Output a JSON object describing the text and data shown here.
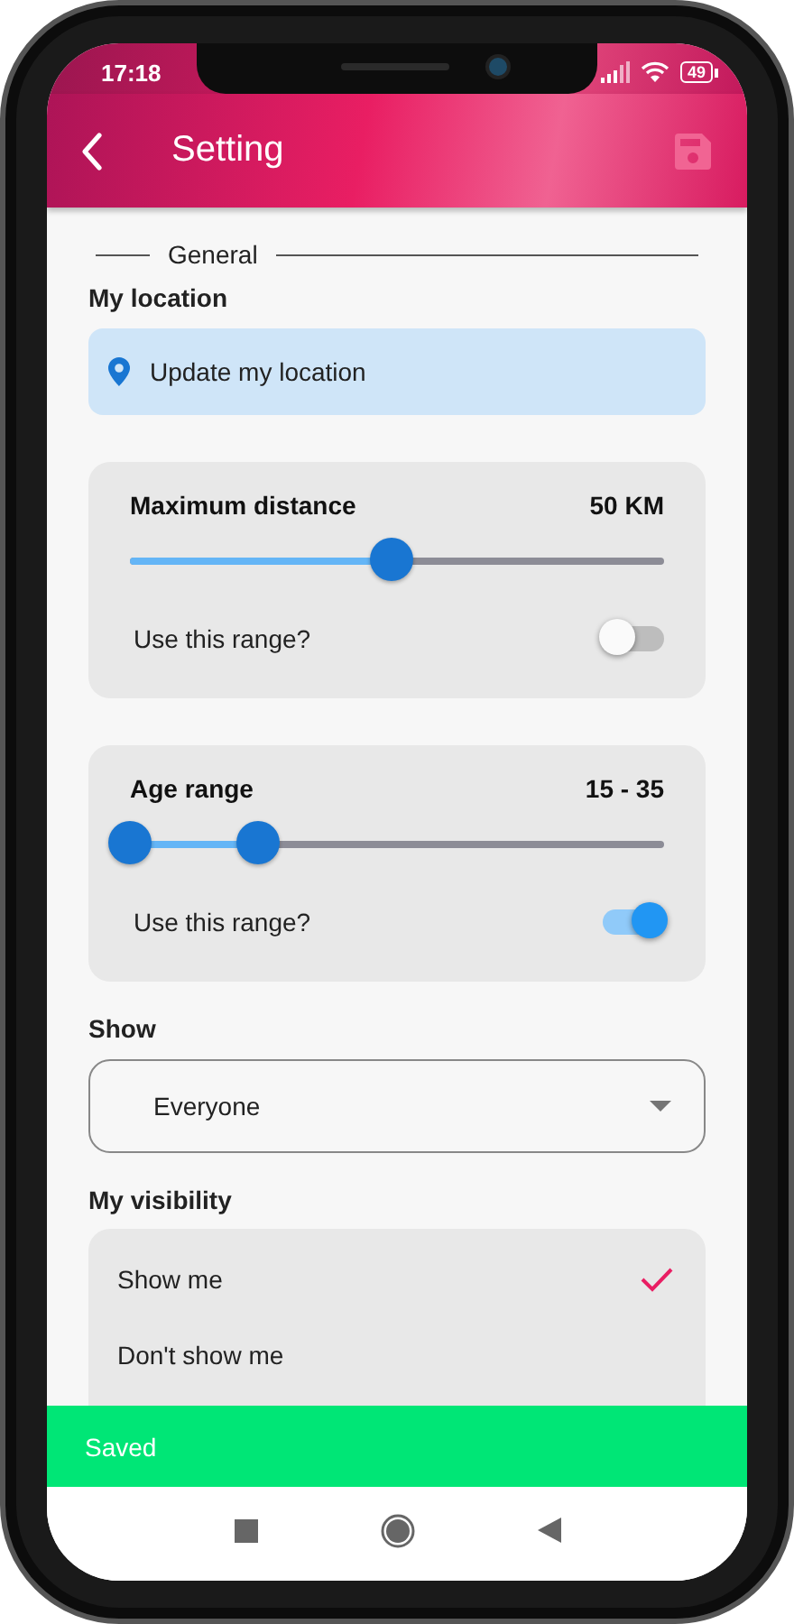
{
  "status_bar": {
    "time": "17:18",
    "battery": "49"
  },
  "app_bar": {
    "title": "Setting"
  },
  "section": {
    "title": "General"
  },
  "location": {
    "label": "My location",
    "button": "Update my location"
  },
  "filters": [
    {
      "kind": "single",
      "title": "Maximum distance",
      "value": "50 KM",
      "thumbs": [
        {
          "level": 0.49
        }
      ],
      "toggle_label": "Use this range?",
      "on": false
    },
    {
      "kind": "range",
      "title": "Age range",
      "value": "15 - 35",
      "thumbs": [
        {
          "level": 0
        },
        {
          "level": 0.24
        }
      ],
      "toggle_label": "Use this range?",
      "on": true
    }
  ],
  "show": {
    "label": "Show",
    "value": "Everyone"
  },
  "visibility": {
    "label": "My visibility",
    "options": [
      {
        "label": "Show me",
        "selected": true
      },
      {
        "label": "Don't show me",
        "selected": false
      }
    ]
  },
  "snackbar": {
    "message": "Saved"
  }
}
